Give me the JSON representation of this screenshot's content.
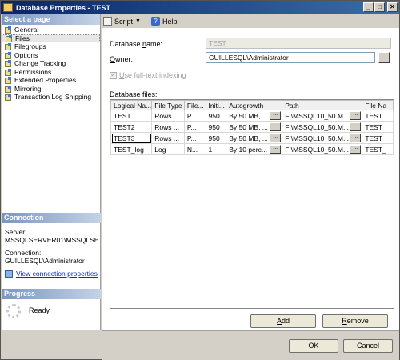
{
  "window": {
    "title": "Database Properties - TEST"
  },
  "left": {
    "select_page_header": "Select a page",
    "pages": [
      "General",
      "Files",
      "Filegroups",
      "Options",
      "Change Tracking",
      "Permissions",
      "Extended Properties",
      "Mirroring",
      "Transaction Log Shipping"
    ],
    "connection_header": "Connection",
    "server_label": "Server:",
    "server_value": "MSSQLSERVER01\\MSSQLSER\\",
    "connection_label": "Connection:",
    "connection_value": "GUILLESQL\\Administrator",
    "view_props_link": "View connection properties",
    "progress_header": "Progress",
    "progress_status": "Ready"
  },
  "toolbar": {
    "script_label": "Script",
    "help_label": "Help"
  },
  "form": {
    "db_name_label_pre": "Database ",
    "db_name_label_u": "n",
    "db_name_label_post": "ame:",
    "db_name_value": "TEST",
    "owner_label_u": "O",
    "owner_label_post": "wner:",
    "owner_value": "GUILLESQL\\Administrator",
    "browse": "...",
    "fulltext_label_u": "U",
    "fulltext_label_post": "se full-text indexing",
    "db_files_label_pre": "Database ",
    "db_files_label_u": "f",
    "db_files_label_post": "iles:"
  },
  "grid": {
    "columns": [
      "Logical Na...",
      "File Type",
      "File...",
      "Initi...",
      "Autogrowth",
      "Path",
      "File Na"
    ],
    "rows": [
      [
        "TEST",
        "Rows ...",
        "P...",
        "950",
        "By 50 MB, ...",
        "F:\\MSSQL10_50.M...",
        "TEST"
      ],
      [
        "TEST2",
        "Rows ...",
        "P...",
        "950",
        "By 50 MB, ...",
        "F:\\MSSQL10_50.M...",
        "TEST"
      ],
      [
        "TEST3",
        "Rows ...",
        "P...",
        "950",
        "By 50 MB, ...",
        "F:\\MSSQL10_50.M...",
        "TEST"
      ],
      [
        "TEST_log",
        "Log",
        "N...",
        "1",
        "By 10 perc...",
        "F:\\MSSQL10_50.M...",
        "TEST_"
      ]
    ]
  },
  "buttons": {
    "add_u": "A",
    "add_post": "dd",
    "remove_u": "R",
    "remove_post": "emove",
    "ok": "OK",
    "cancel": "Cancel"
  }
}
